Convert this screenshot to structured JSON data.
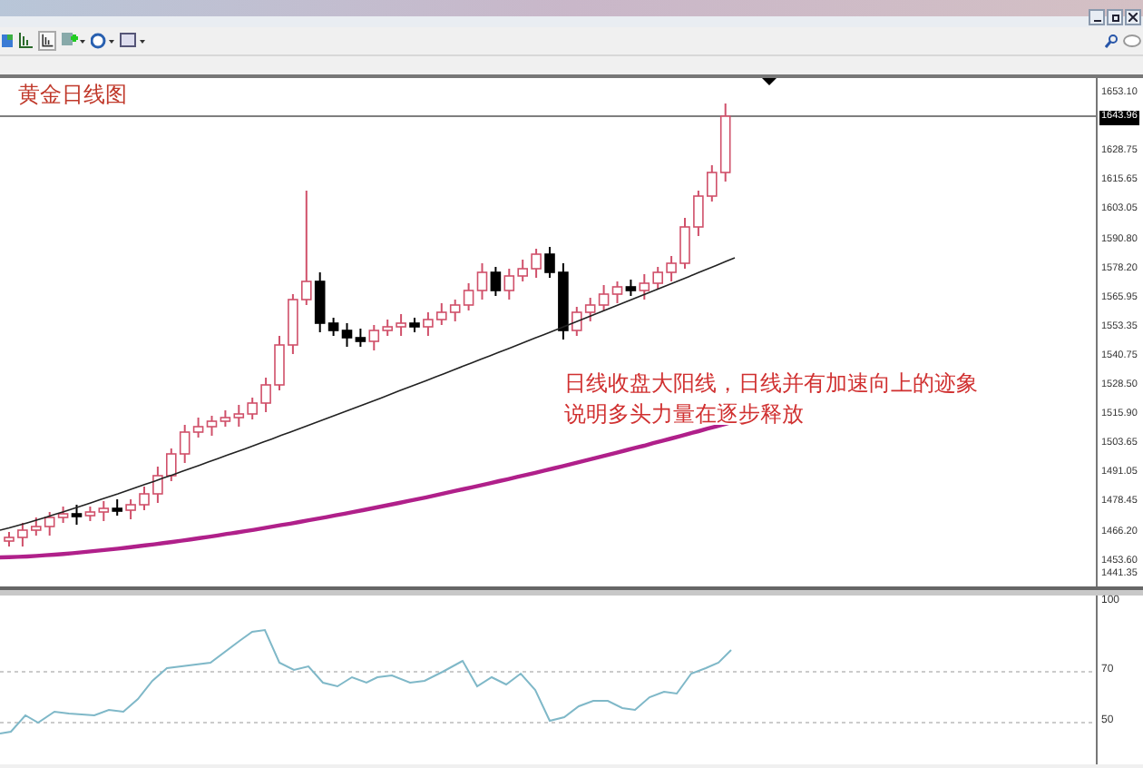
{
  "chart": {
    "title": "黄金日线图",
    "annotation": [
      "日线收盘大阳线，日线并有加速向上的迹象",
      "说明多头力量在逐步释放"
    ],
    "current_price": "1643.96",
    "price_axis": [
      "1653.10",
      "1628.75",
      "1615.65",
      "1603.05",
      "1590.80",
      "1578.20",
      "1565.95",
      "1553.35",
      "1540.75",
      "1528.50",
      "1515.90",
      "1503.65",
      "1491.05",
      "1478.45",
      "1466.20",
      "1453.60",
      "1441.35"
    ]
  },
  "indicator": {
    "axis": [
      "100",
      "70",
      "50"
    ]
  }
}
